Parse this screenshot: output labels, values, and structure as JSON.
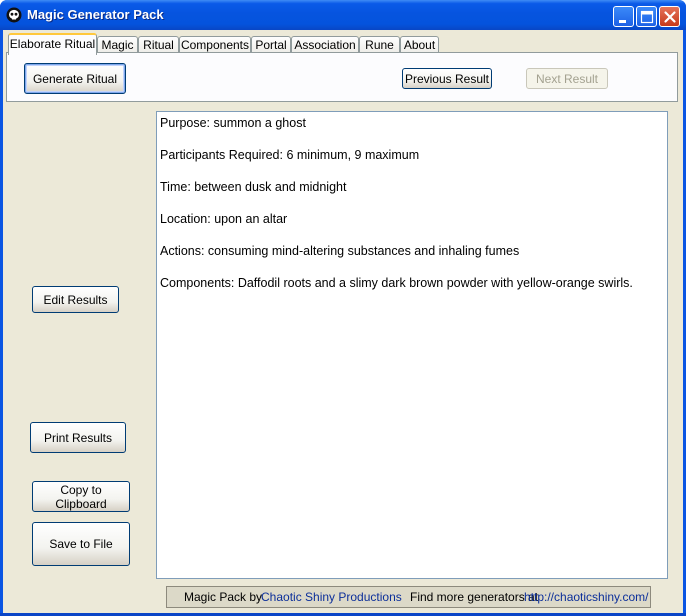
{
  "window": {
    "title": "Magic Generator Pack"
  },
  "tabs": [
    {
      "label": "Elaborate Ritual",
      "active": true
    },
    {
      "label": "Magic",
      "active": false
    },
    {
      "label": "Ritual",
      "active": false
    },
    {
      "label": "Components",
      "active": false
    },
    {
      "label": "Portal",
      "active": false
    },
    {
      "label": "Association",
      "active": false
    },
    {
      "label": "Rune",
      "active": false
    },
    {
      "label": "About",
      "active": false
    }
  ],
  "toolbar": {
    "generate_label": "Generate Ritual",
    "previous_label": "Previous Result",
    "next_label": "Next Result"
  },
  "side_buttons": {
    "edit_label": "Edit Results",
    "print_label": "Print Results",
    "copy_label": "Copy to Clipboard",
    "save_label": "Save to File"
  },
  "results": {
    "lines": [
      "Purpose: summon a ghost",
      "Participants Required: 6 minimum, 9 maximum",
      "Time: between dusk and midnight",
      "Location: upon an altar",
      "Actions: consuming mind-altering substances and inhaling fumes",
      "Components: Daffodil roots and a slimy dark brown powder with yellow-orange swirls."
    ]
  },
  "status": {
    "prefix": "Magic Pack by",
    "author_link": "Chaotic Shiny Productions",
    "more_text": "Find more generators at",
    "url_link": "http://chaoticshiny.com/"
  },
  "colors": {
    "titlebar": "#0a55e3",
    "dialog_bg": "#ece9d8",
    "active_tab_accent": "#ffc83c",
    "link": "#0c2f9a"
  }
}
